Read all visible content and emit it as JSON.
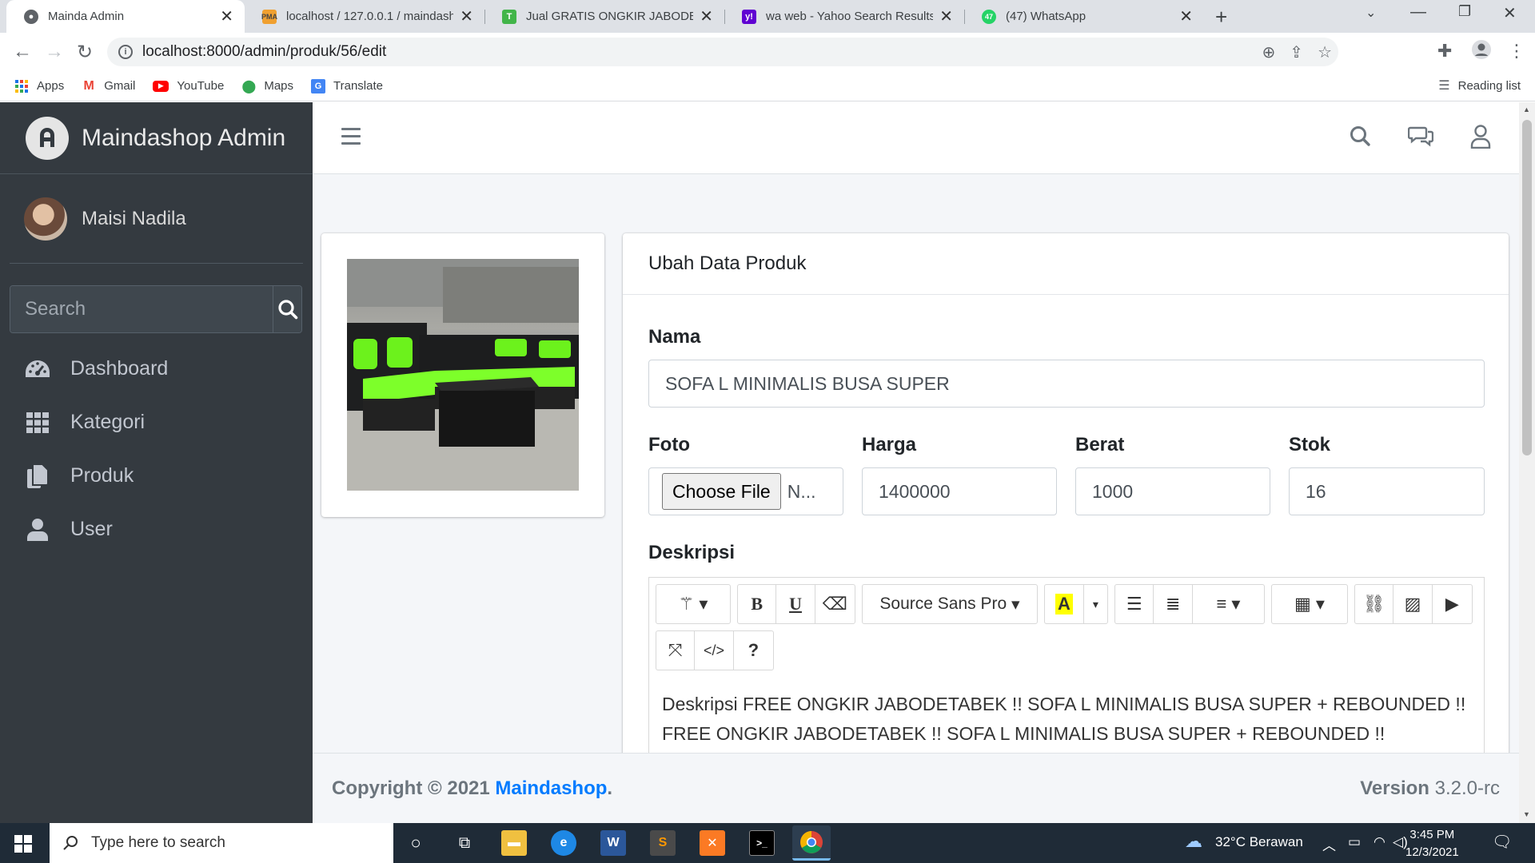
{
  "browser": {
    "tabs": [
      {
        "title": "Mainda Admin",
        "active": true
      },
      {
        "title": "localhost / 127.0.0.1 / maindashop"
      },
      {
        "title": "Jual GRATIS ONGKIR JABODETABEK"
      },
      {
        "title": "wa web - Yahoo Search Results"
      },
      {
        "title": "(47) WhatsApp"
      }
    ],
    "url": "localhost:8000/admin/produk/56/edit",
    "bookmarks": [
      "Apps",
      "Gmail",
      "YouTube",
      "Maps",
      "Translate"
    ],
    "reading_list": "Reading list"
  },
  "sidebar": {
    "brand": "Maindashop Admin",
    "user": "Maisi Nadila",
    "search_placeholder": "Search",
    "menu": [
      {
        "label": "Dashboard",
        "icon": "dashboard-icon"
      },
      {
        "label": "Kategori",
        "icon": "grid-icon"
      },
      {
        "label": "Produk",
        "icon": "copy-icon"
      },
      {
        "label": "User",
        "icon": "user-icon"
      }
    ]
  },
  "form": {
    "title": "Ubah Data Produk",
    "nama_label": "Nama",
    "nama_value": "SOFA L MINIMALIS BUSA SUPER",
    "foto_label": "Foto",
    "file_button": "Choose File",
    "file_name": "N...",
    "harga_label": "Harga",
    "harga_value": "1400000",
    "berat_label": "Berat",
    "berat_value": "1000",
    "stok_label": "Stok",
    "stok_value": "16",
    "deskripsi_label": "Deskripsi",
    "font_name": "Source Sans Pro",
    "description_line1": "Deskripsi FREE ONGKIR JABODETABEK !! SOFA L MINIMALIS BUSA SUPER + REBOUNDED !!",
    "description_line2": "FREE ONGKIR JABODETABEK !! SOFA L MINIMALIS BUSA SUPER + REBOUNDED !!"
  },
  "footer": {
    "copyright": "Copyright © 2021",
    "brand_link": "Maindashop",
    "version_label": "Version",
    "version": "3.2.0-rc"
  },
  "taskbar": {
    "search_placeholder": "Type here to search",
    "weather": "32°C  Berawan",
    "time": "3:45 PM",
    "date": "12/3/2021"
  },
  "colors": {
    "sidebar": "#343a40",
    "content_bg": "#f4f6f9",
    "link": "#007bff",
    "taskbar": "#1f2b37"
  }
}
